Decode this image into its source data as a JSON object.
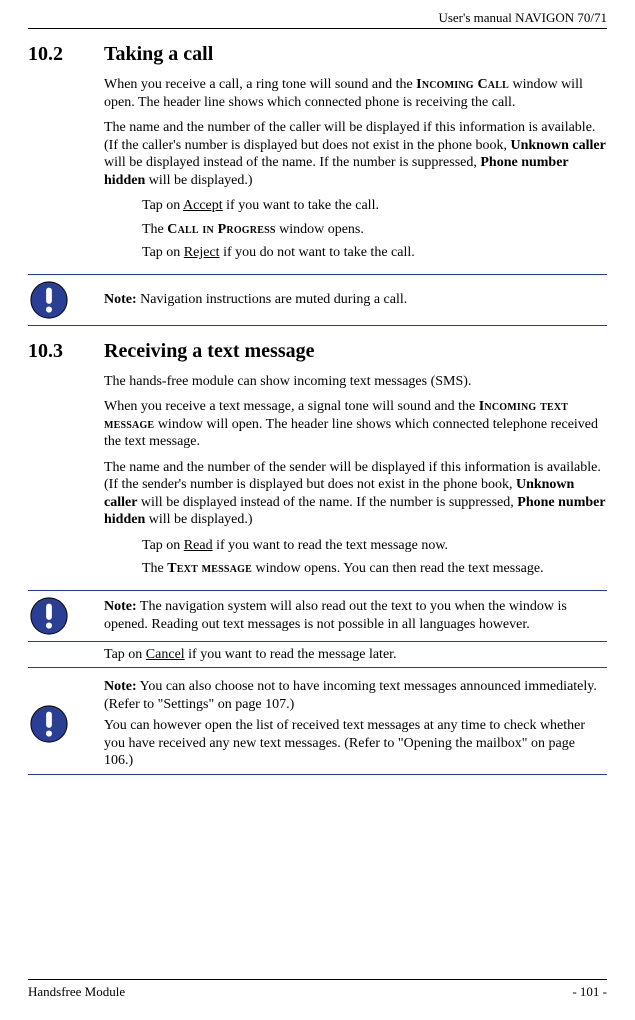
{
  "header": {
    "title": "User's manual NAVIGON 70/71"
  },
  "sections": {
    "s1": {
      "num": "10.2",
      "title": "Taking a call",
      "p1_a": "When you receive a call, a ring tone will sound and the ",
      "p1_scaps": "Incoming Call",
      "p1_b": " window will open. The header line shows which connected phone is receiving the call.",
      "p2_a": "The name and the number of the caller will be displayed if this information is available. (If the caller's number is displayed but does not exist in the phone book, ",
      "p2_bold1": "Unknown caller",
      "p2_b": " will be displayed instead of the name. If the number is suppressed, ",
      "p2_bold2": "Phone number hidden",
      "p2_c": " will be displayed.)",
      "sub1_a": "Tap on ",
      "sub1_u": "Accept",
      "sub1_b": " if you want to take the call.",
      "sub2_a": "The ",
      "sub2_scaps": "Call in Progress",
      "sub2_b": " window opens.",
      "sub3_a": "Tap on ",
      "sub3_u": "Reject",
      "sub3_b": " if you do not want to take the call."
    },
    "note1": {
      "label": "Note:",
      "text": " Navigation instructions are muted during a call."
    },
    "s2": {
      "num": "10.3",
      "title": "Receiving a text message",
      "p1": "The hands-free module can show incoming text messages (SMS).",
      "p2_a": "When you receive a text message, a signal tone will sound and the ",
      "p2_scaps": "Incoming text message",
      "p2_b": " window will open. The header line shows which connected telephone received the text message.",
      "p3_a": "The name and the number of the sender will be displayed if this information is available. (If the sender's number is displayed but does not exist in the phone book, ",
      "p3_bold1": "Unknown caller",
      "p3_b": " will be displayed instead of the name. If the number is suppressed, ",
      "p3_bold2": "Phone number hidden",
      "p3_c": " will be displayed.)",
      "sub1_a": "Tap on ",
      "sub1_u": "Read",
      "sub1_b": " if you want to read the text message now.",
      "sub2_a": "The ",
      "sub2_scaps": "Text message",
      "sub2_b": " window opens. You can then read the text message."
    },
    "note2": {
      "label": "Note:",
      "text": " The navigation system will also read out the text to you when the window is opened. Reading out text messages is not possible in all languages however."
    },
    "intermediate": {
      "a": "Tap on ",
      "u": "Cancel",
      "b": " if you want to read the message later."
    },
    "note3": {
      "label": "Note:",
      "p1": " You can also choose not to have incoming text messages announced immediately. (Refer to \"Settings\" on page 107.)",
      "p2": "You can however open the list of received text messages at any time to check whether you have received any new text messages. (Refer to \"Opening the mailbox\" on page 106.)"
    }
  },
  "footer": {
    "left": "Handsfree Module",
    "right": "- 101 -"
  }
}
